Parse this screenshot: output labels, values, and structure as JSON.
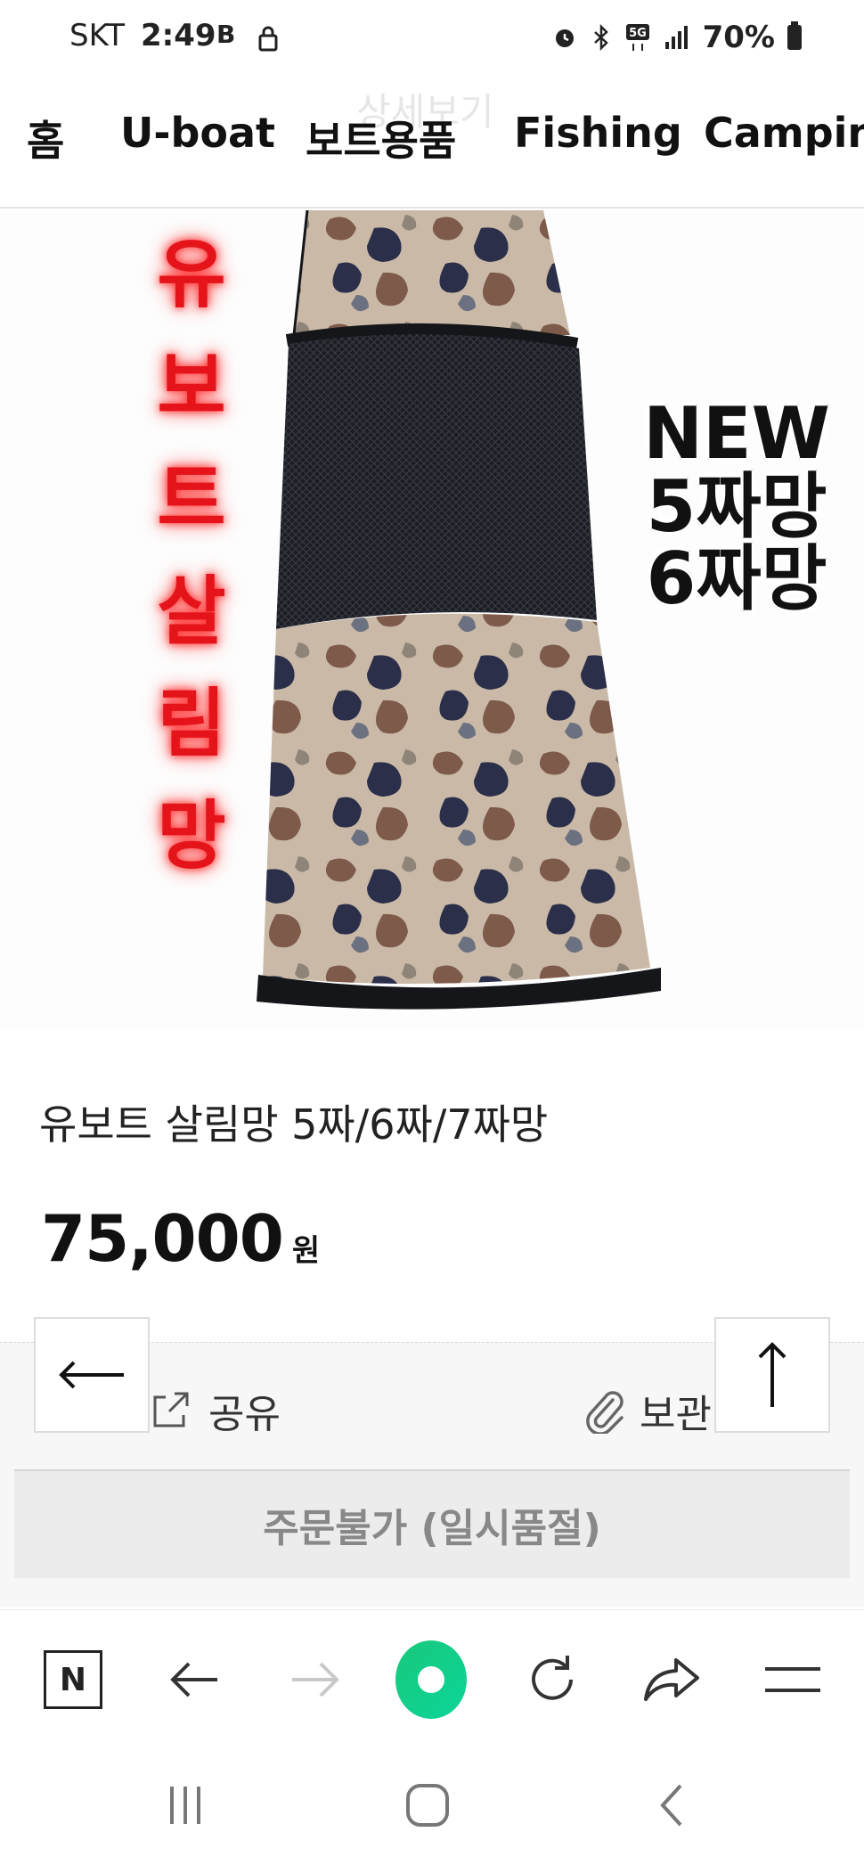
{
  "status_bar": {
    "carrier": "SKT",
    "time": "2:49",
    "b_icon_text": "B",
    "battery_percent": "70%",
    "icons": [
      "alarm-icon",
      "bluetooth-icon",
      "5g-icon",
      "signal-icon",
      "battery-icon"
    ]
  },
  "header": {
    "ghost_title": "상세보기",
    "categories": [
      "홈",
      "U-boat",
      "보트용품",
      "Fishing",
      "Camping"
    ]
  },
  "product_image": {
    "vertical_text": [
      "유",
      "보",
      "트",
      "살",
      "림",
      "망"
    ],
    "badge_lines": [
      "NEW",
      "5짜망",
      "6짜망"
    ],
    "colors": {
      "neon_red": "#e5141b",
      "camo_dark": "#2b2f3c",
      "camo_brown": "#7d5a4a",
      "camo_tan": "#c9b9a6"
    }
  },
  "product": {
    "name": "유보트 살림망 5짜/6짜/7짜망",
    "price": "75,000",
    "currency": "원"
  },
  "actions": {
    "share_label": "공유",
    "save_label": "보관",
    "order_label": "주문불가 (일시품절)"
  },
  "floating": {
    "back_icon": "arrow-left-icon",
    "top_icon": "arrow-up-icon"
  },
  "browser_toolbar": {
    "naver_label": "N",
    "icons": [
      "naver-home-icon",
      "back-arrow-icon",
      "forward-arrow-icon",
      "green-home-icon",
      "refresh-icon",
      "share-arrow-icon",
      "menu-icon"
    ],
    "accent_color": "#19c87a"
  },
  "system_nav": {
    "icons": [
      "recent-apps-icon",
      "home-square-icon",
      "system-back-icon"
    ]
  }
}
